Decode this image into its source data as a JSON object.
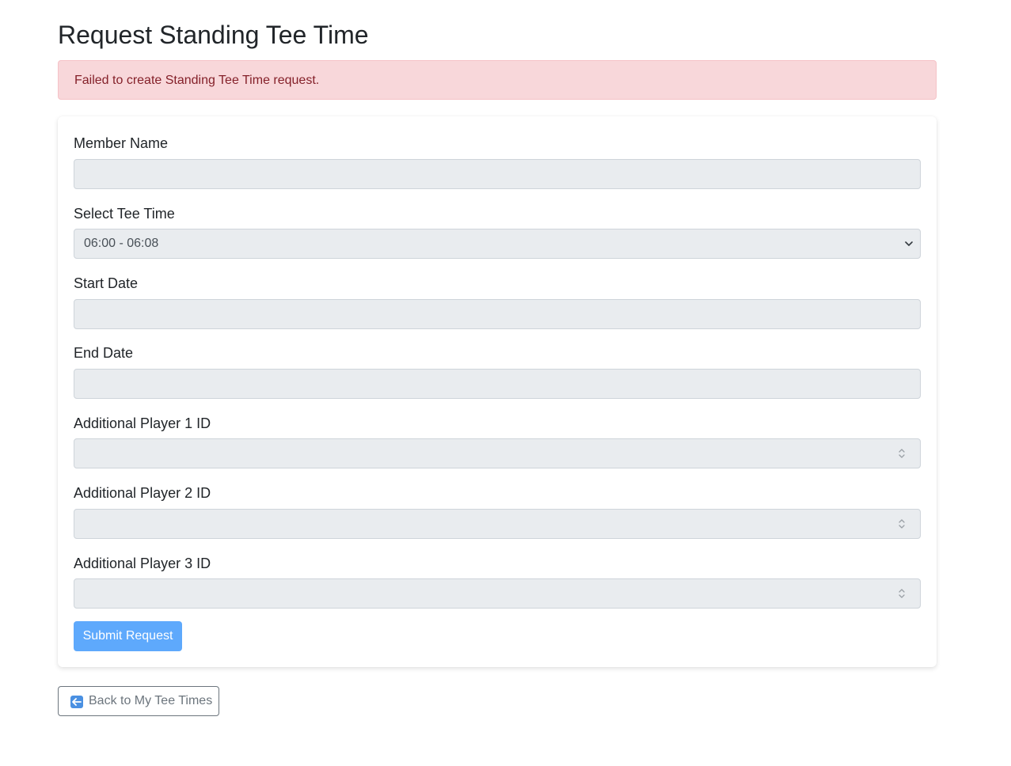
{
  "page": {
    "title": "Request Standing Tee Time"
  },
  "alert": {
    "message": "Failed to create Standing Tee Time request."
  },
  "form": {
    "member_name": {
      "label": "Member Name",
      "value": ""
    },
    "tee_time": {
      "label": "Select Tee Time",
      "selected": "06:00 - 06:08"
    },
    "start_date": {
      "label": "Start Date",
      "value": ""
    },
    "end_date": {
      "label": "End Date",
      "value": ""
    },
    "player1": {
      "label": "Additional Player 1 ID",
      "value": ""
    },
    "player2": {
      "label": "Additional Player 2 ID",
      "value": ""
    },
    "player3": {
      "label": "Additional Player 3 ID",
      "value": ""
    },
    "submit_label": "Submit Request"
  },
  "back": {
    "label": "Back to My Tee Times",
    "icon": "left-arrow-icon"
  },
  "colors": {
    "alert_bg": "#f8d7da",
    "alert_text": "#842029",
    "input_bg": "#e9ecef",
    "submit_bg": "#5ea9fc",
    "back_border": "#6c757d"
  }
}
